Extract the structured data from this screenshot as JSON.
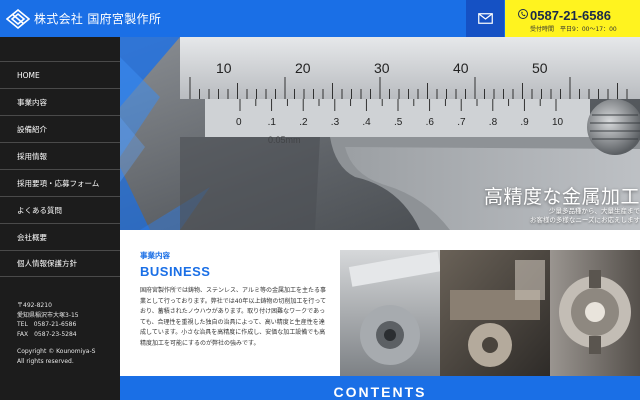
{
  "header": {
    "brand": "株式会社 国府宮製作所",
    "phone": "0587-21-6586",
    "hours": "受付時間　平日9：00～17：00"
  },
  "sidebar": {
    "items": [
      {
        "label": "HOME"
      },
      {
        "label": "事業内容"
      },
      {
        "label": "設備紹介"
      },
      {
        "label": "採用情報"
      },
      {
        "label": "採用要項・応募フォーム"
      },
      {
        "label": "よくある質問"
      },
      {
        "label": "会社概要"
      },
      {
        "label": "個人情報保護方針"
      }
    ],
    "address": {
      "zip": "〒492-8210",
      "addr": "愛知県稲沢市大塚3-15",
      "tel": "TEL　0587-21-6586",
      "fax": "FAX　0587-23-5284"
    },
    "copyright": {
      "line1": "Copyright © Kounomiya-S",
      "line2": "All rights reserved."
    }
  },
  "hero": {
    "title": "高精度な金属加工",
    "sub1": "少量多品種から、大量生産まで",
    "sub2": "お客様の多様なニーズにお応えします"
  },
  "business": {
    "label": "事業内容",
    "title": "BUSINESS",
    "text": "国府宮製作所では鋳物、ステンレス、アルミ等の金属加工を主たる事業として行っております。弊社では40年以上鋳物の切削加工を行っており、蓄積されたノウハウがあります。取り付け困難なワークであっても、合理性を重視した独自の治具によって、高い精度と生産性を達成しています。小さな治具を高精度に作成し、安価な加工設備でも高精度加工を可能にするのが弊社の強みです。"
  },
  "contents": {
    "title": "CONTENTS"
  },
  "ruler": {
    "main_ticks": [
      "10",
      "20",
      "30",
      "40",
      "50"
    ],
    "vernier_ticks": [
      "0",
      ".1",
      ".2",
      ".3",
      ".4",
      ".5",
      ".6",
      ".7",
      ".8",
      ".9",
      "10"
    ],
    "unit": "0.05mm"
  },
  "colors": {
    "brand_blue": "#1a6fe6",
    "phone_yellow": "#fff31f",
    "sidebar": "#1c1c1c"
  }
}
